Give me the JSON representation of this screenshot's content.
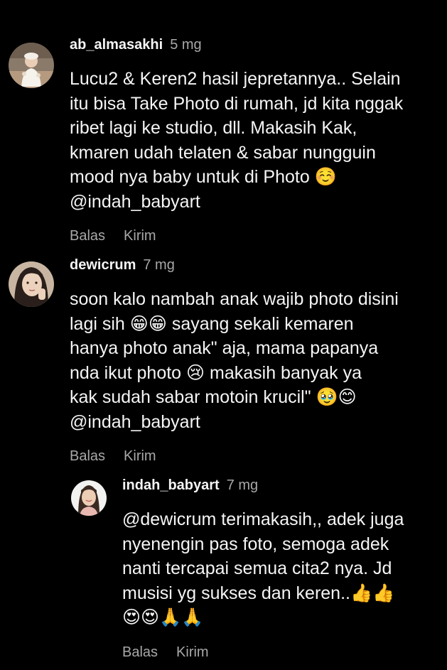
{
  "comments": [
    {
      "username": "ab_almasakhi",
      "time": "5 mg",
      "lines": [
        "Lucu2 & Keren2 hasil jepretannya.. Selain",
        "itu bisa Take Photo di rumah, jd kita nggak",
        "ribet lagi ke studio, dll. Makasih Kak,",
        "kmaren udah telaten & sabar nungguin",
        "mood nya baby untuk di Photo ☺️",
        "@indah_babyart"
      ],
      "reply_label": "Balas",
      "send_label": "Kirim"
    },
    {
      "username": "dewicrum",
      "time": "7 mg",
      "lines": [
        "soon kalo nambah anak wajib photo disini",
        "lagi sih 😁😁 sayang sekali kemaren",
        "hanya photo anak\" aja, mama papanya",
        "nda ikut photo 😢 makasih banyak ya",
        "kak sudah sabar motoin krucil\" 🥹😊",
        "@indah_babyart"
      ],
      "reply_label": "Balas",
      "send_label": "Kirim"
    }
  ],
  "reply": {
    "username": "indah_babyart",
    "time": "7 mg",
    "lines": [
      "@dewicrum terimakasih,, adek juga",
      "nyenengin pas foto, semoga adek",
      "nanti tercapai semua cita2 nya. Jd",
      "musisi yg sukses dan keren..👍👍",
      "😍😍🙏🙏"
    ],
    "reply_label": "Balas",
    "send_label": "Kirim"
  }
}
